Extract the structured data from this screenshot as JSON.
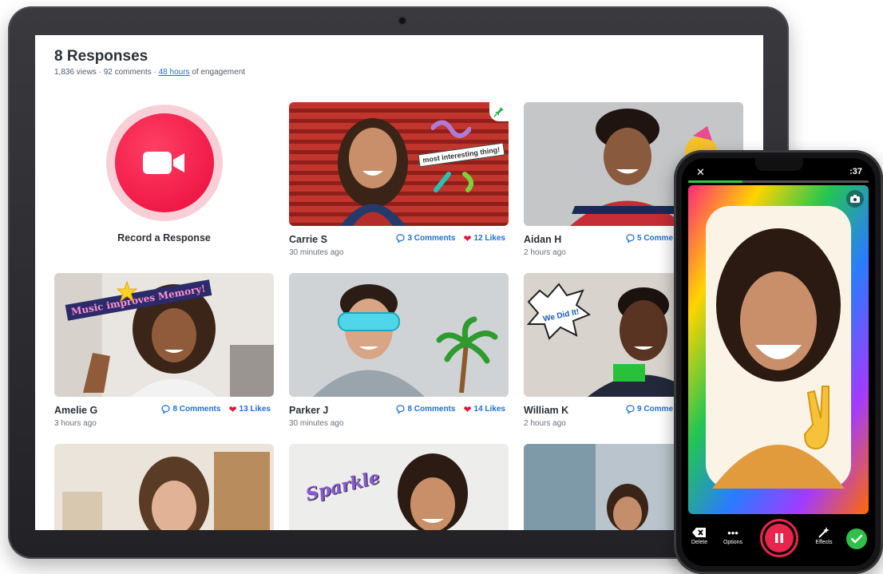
{
  "page": {
    "title": "8 Responses",
    "stats_prefix": "1,836 views · 92 comments · ",
    "stats_link": "48 hours",
    "stats_suffix": " of engagement"
  },
  "record": {
    "label": "Record a Response"
  },
  "cards": [
    {
      "name": "Carrie S",
      "time": "30 minutes ago",
      "comments": "3 Comments",
      "likes": "12 Likes",
      "sticker": "most interesting thing!"
    },
    {
      "name": "Aidan H",
      "time": "2 hours ago",
      "comments": "5 Comme",
      "likes": ""
    },
    {
      "name": "Amelie G",
      "time": "3 hours ago",
      "comments": "8 Comments",
      "likes": "13 Likes",
      "sticker": "Music improves Memory!"
    },
    {
      "name": "Parker J",
      "time": "30 minutes ago",
      "comments": "8 Comments",
      "likes": "14 Likes"
    },
    {
      "name": "William K",
      "time": "2 hours ago",
      "comments": "9 Comme",
      "likes": "",
      "sticker": "We Did It!"
    },
    {
      "sticker": "Sparkle"
    }
  ],
  "phone": {
    "close": "✕",
    "timer": ":37",
    "progress": 0.3,
    "controls": {
      "delete": "Delete",
      "options": "Options",
      "effects": "Effects"
    }
  },
  "colors": {
    "accent": "#1f6fd1",
    "record": "#f01a48",
    "like": "#e3153f",
    "done": "#2fbf4a"
  },
  "icons": [
    "video-camera-icon",
    "pin-icon",
    "comment-bubble-icon",
    "heart-icon",
    "close-icon",
    "camera-flip-icon",
    "delete-icon",
    "more-options-icon",
    "pause-icon",
    "effects-wand-icon",
    "checkmark-icon"
  ]
}
